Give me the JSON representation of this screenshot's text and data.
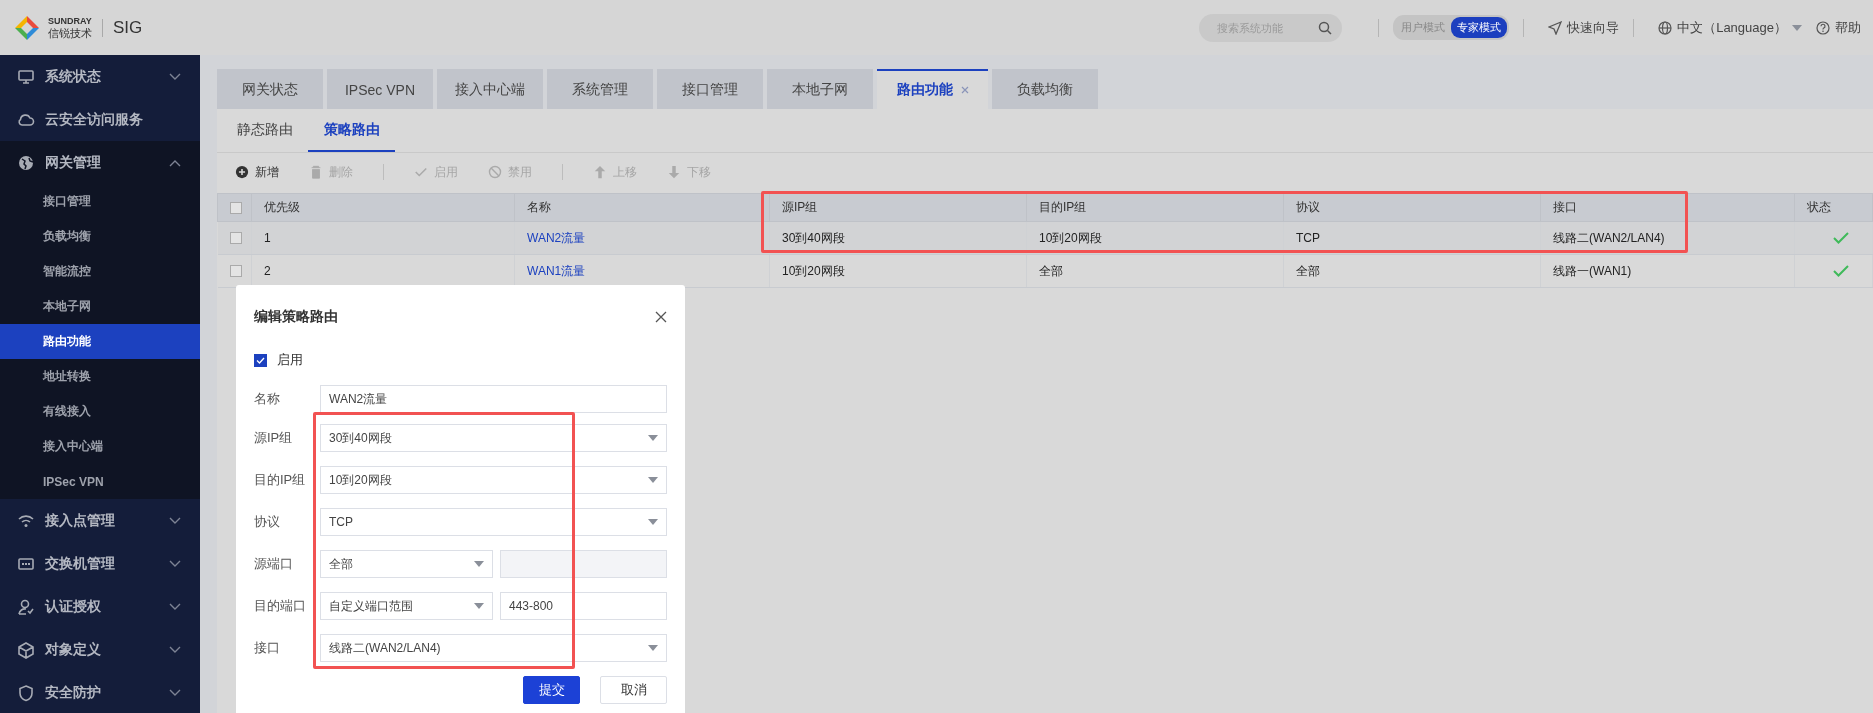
{
  "header": {
    "brand_name": "SUNDRAY",
    "brand_cn": "信锐技术",
    "product": "SIG",
    "search": {
      "placeholder": "搜索系统功能"
    },
    "modes": [
      {
        "label": "用户模式",
        "selected": false
      },
      {
        "label": "专家模式",
        "selected": true
      }
    ],
    "quick_guide": "快速向导",
    "language": "中文（Language）",
    "help": "帮助"
  },
  "sidebar": {
    "items": [
      {
        "label": "系统状态",
        "kind": "group",
        "expanded": false
      },
      {
        "label": "云安全访问服务",
        "kind": "link"
      },
      {
        "label": "网关管理",
        "kind": "group",
        "expanded": true,
        "children": [
          {
            "label": "接口管理",
            "selected": false
          },
          {
            "label": "负载均衡",
            "selected": false
          },
          {
            "label": "智能流控",
            "selected": false
          },
          {
            "label": "本地子网",
            "selected": false
          },
          {
            "label": "路由功能",
            "selected": true
          },
          {
            "label": "地址转换",
            "selected": false
          },
          {
            "label": "有线接入",
            "selected": false
          },
          {
            "label": "接入中心端",
            "selected": false
          },
          {
            "label": "IPSec VPN",
            "selected": false
          }
        ]
      },
      {
        "label": "接入点管理",
        "kind": "group",
        "expanded": false
      },
      {
        "label": "交换机管理",
        "kind": "group",
        "expanded": false
      },
      {
        "label": "认证授权",
        "kind": "group",
        "expanded": false
      },
      {
        "label": "对象定义",
        "kind": "group",
        "expanded": false
      },
      {
        "label": "安全防护",
        "kind": "group",
        "expanded": false
      }
    ]
  },
  "tabs": [
    {
      "label": "网关状态",
      "selected": false
    },
    {
      "label": "IPSec VPN",
      "selected": false
    },
    {
      "label": "接入中心端",
      "selected": false
    },
    {
      "label": "系统管理",
      "selected": false
    },
    {
      "label": "接口管理",
      "selected": false
    },
    {
      "label": "本地子网",
      "selected": false
    },
    {
      "label": "路由功能",
      "selected": true
    },
    {
      "label": "负载均衡",
      "selected": false
    }
  ],
  "subtabs": [
    {
      "label": "静态路由",
      "selected": false
    },
    {
      "label": "策略路由",
      "selected": true
    }
  ],
  "toolbar": [
    {
      "label": "新增",
      "disabled": false
    },
    {
      "label": "删除",
      "disabled": true
    },
    {
      "label": "启用",
      "disabled": true
    },
    {
      "label": "禁用",
      "disabled": true
    },
    {
      "label": "上移",
      "disabled": true
    },
    {
      "label": "下移",
      "disabled": true
    }
  ],
  "table": {
    "all_checked": false,
    "columns": [
      "优先级",
      "名称",
      "源IP组",
      "目的IP组",
      "协议",
      "接口",
      "状态"
    ],
    "rows": [
      {
        "checked": false,
        "enabled": true,
        "cells": [
          "1",
          "WAN2流量",
          "30到40网段",
          "10到20网段",
          "TCP",
          "线路二(WAN2/LAN4)"
        ]
      },
      {
        "checked": false,
        "enabled": true,
        "cells": [
          "2",
          "WAN1流量",
          "10到20网段",
          "全部",
          "全部",
          "线路一(WAN1)"
        ]
      }
    ]
  },
  "dialog": {
    "title": "编辑策略路由",
    "enable": {
      "label": "启用",
      "checked": true
    },
    "fields": [
      {
        "label": "名称",
        "kind": "text",
        "value": "WAN2流量"
      },
      {
        "label": "源IP组",
        "kind": "select",
        "value": "30到40网段"
      },
      {
        "label": "目的IP组",
        "kind": "select",
        "value": "10到20网段"
      },
      {
        "label": "协议",
        "kind": "select",
        "value": "TCP"
      },
      {
        "label": "源端口",
        "kind": "select-pair",
        "value": "全部",
        "extra": {
          "disabled": true
        }
      },
      {
        "label": "目的端口",
        "kind": "select-pair",
        "value": "自定义端口范围",
        "extra": {
          "disabled": false,
          "value": "443-800"
        }
      },
      {
        "label": "接口",
        "kind": "select",
        "value": "线路二(WAN2/LAN4)"
      }
    ],
    "buttons": [
      {
        "label": "提交",
        "kind": "primary"
      },
      {
        "label": "取消",
        "kind": "default"
      }
    ]
  }
}
